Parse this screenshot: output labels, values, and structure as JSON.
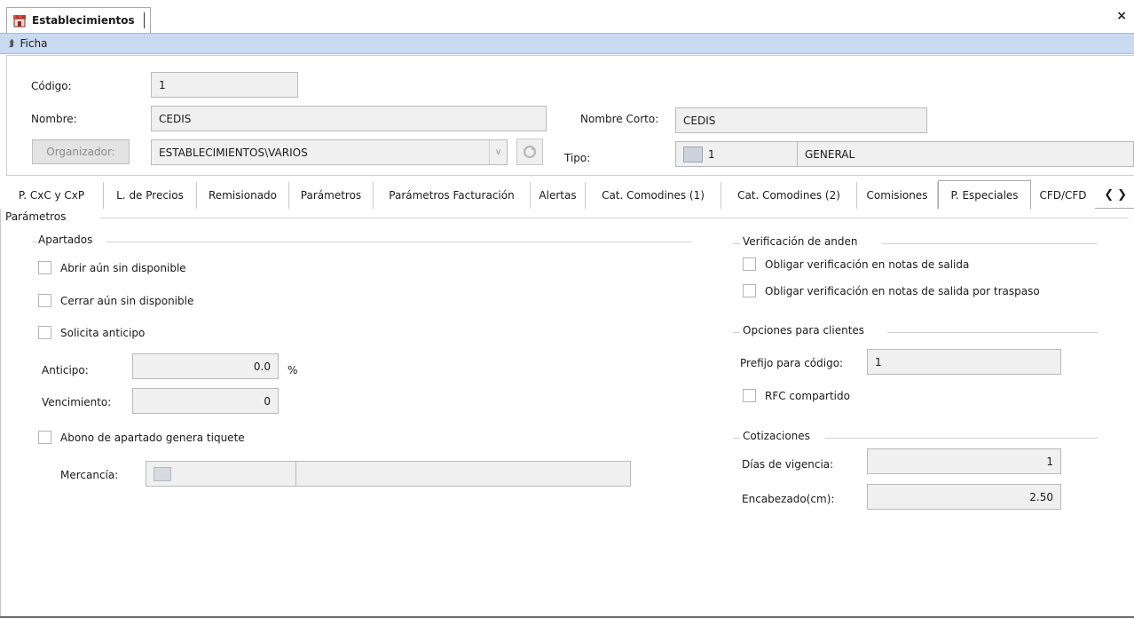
{
  "window": {
    "title": "Establecimientos",
    "close": "×"
  },
  "ficha": {
    "label": "Ficha"
  },
  "header": {
    "codigo_label": "Código:",
    "codigo_value": "1",
    "nombre_label": "Nombre:",
    "nombre_value": "CEDIS",
    "nombre_corto_label": "Nombre Corto:",
    "nombre_corto_value": "CEDIS",
    "organizador_button": "Organizador:",
    "organizador_value": "ESTABLECIMIENTOS\\VARIOS",
    "tipo_label": "Tipo:",
    "tipo_code": "1",
    "tipo_name": "GENERAL"
  },
  "tabs": [
    "P. CxC y CxP",
    "L. de Precios",
    "Remisionado",
    "Parámetros",
    "Parámetros Facturación",
    "Alertas",
    "Cat. Comodines (1)",
    "Cat. Comodines (2)",
    "Comisiones",
    "P. Especiales",
    "CFD/CFD"
  ],
  "active_tab": "P. Especiales",
  "content": {
    "section_title": "Parámetros",
    "apartados": {
      "title": "Apartados",
      "chk_abrir": "Abrir aún sin disponible",
      "chk_cerrar": "Cerrar aún sin disponible",
      "chk_anticipo": "Solicita anticipo",
      "anticipo_label": "Anticipo:",
      "anticipo_value": "0.0",
      "anticipo_unit": "%",
      "vencimiento_label": "Vencimiento:",
      "vencimiento_value": "0",
      "chk_abono": "Abono de apartado genera tiquete",
      "mercancia_label": "Mercancía:"
    },
    "verificacion": {
      "title": "Verificación de anden",
      "chk_salida": "Obligar verificación en notas de salida",
      "chk_traspaso": "Obligar verificación en notas de salida por traspaso"
    },
    "clientes": {
      "title": "Opciones para clientes",
      "prefijo_label": "Prefijo para código:",
      "prefijo_value": "1",
      "chk_rfc": "RFC compartido"
    },
    "cotizaciones": {
      "title": "Cotizaciones",
      "dias_label": "Días de vigencia:",
      "dias_value": "1",
      "encabezado_label": "Encabezado(cm):",
      "encabezado_value": "2.50"
    }
  }
}
